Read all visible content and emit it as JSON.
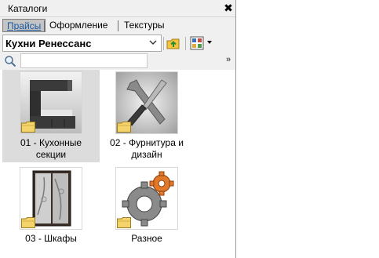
{
  "window": {
    "title": "Каталоги",
    "close_glyph": "✖"
  },
  "tabs": [
    {
      "label": "Прайсы",
      "active": true
    },
    {
      "label": "Оформление",
      "active": false
    },
    {
      "label": "Текстуры",
      "active": false
    }
  ],
  "toolbar": {
    "catalog_selected": "Кухни Ренессанс",
    "icons": [
      "folder-up-icon",
      "view-mode-icon",
      "dropdown-arrow-icon"
    ]
  },
  "search": {
    "value": "",
    "placeholder": "",
    "expand_glyph": "»"
  },
  "items": [
    {
      "label_line1": "01 - Кухонные",
      "label_line2": "секции",
      "icon": "kitchen-cabinet-thumbnail",
      "selected": true
    },
    {
      "label_line1": "02 - Фурнитура и",
      "label_line2": "дизайн",
      "icon": "tools-thumbnail",
      "selected": false
    },
    {
      "label_line1": "03 - Шкафы",
      "label_line2": "",
      "icon": "wardrobe-thumbnail",
      "selected": false
    },
    {
      "label_line1": "Разное",
      "label_line2": "",
      "icon": "gears-thumbnail",
      "selected": false
    }
  ],
  "colors": {
    "panel_bg": "#f0f0f0",
    "active_tab_bg": "#c4c4c4",
    "active_tab_text": "#1a58a0",
    "selection_bg": "#dcdcdc",
    "folder_yellow": "#f5d36b"
  }
}
